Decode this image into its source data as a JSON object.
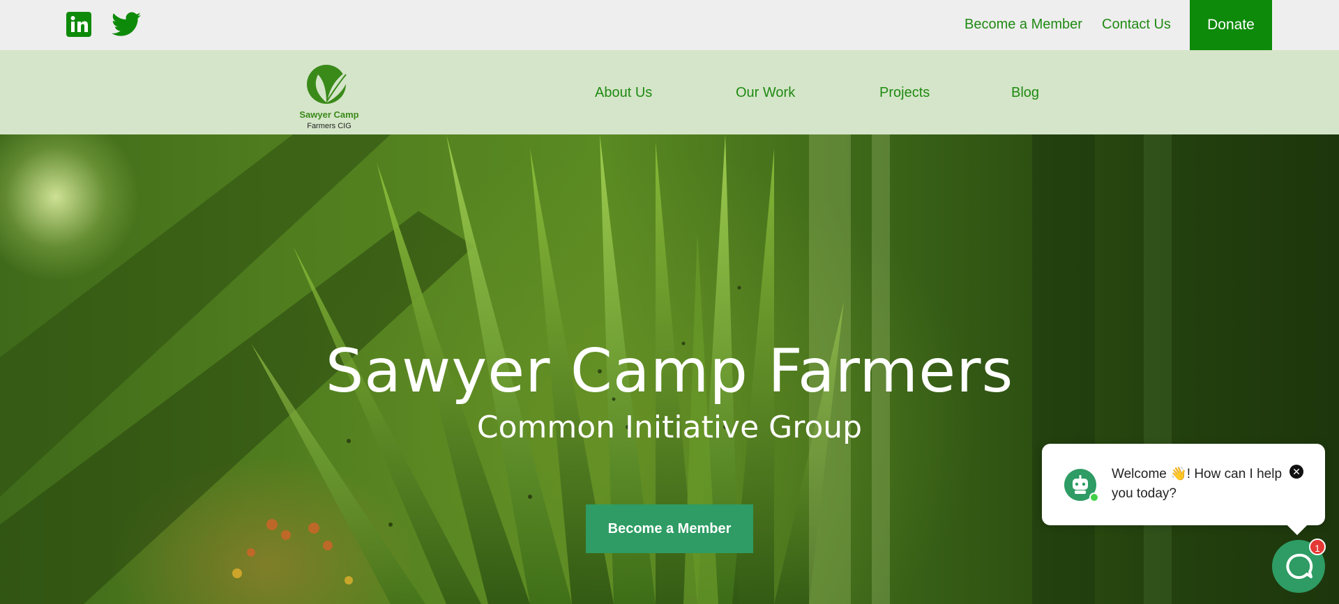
{
  "topbar": {
    "social": [
      {
        "name": "linkedin-icon"
      },
      {
        "name": "twitter-icon"
      }
    ],
    "links": {
      "become_member": "Become a Member",
      "contact_us": "Contact Us",
      "donate": "Donate"
    }
  },
  "nav": {
    "logo": {
      "name": "Sawyer Camp",
      "sub": "Farmers CIG"
    },
    "items": [
      "About Us",
      "Our Work",
      "Projects",
      "Blog"
    ]
  },
  "hero": {
    "title": "Sawyer Camp Farmers",
    "subtitle": "Common Initiative Group",
    "cta": "Become a Member"
  },
  "chat": {
    "message": "Welcome 👋! How can I help you today?",
    "close": "✕",
    "badge": "1"
  },
  "colors": {
    "brand_green": "#1f8a12",
    "donate_bg": "#0e8a0a",
    "nav_bg": "#d5e5c9",
    "cta_bg": "#2e9c64"
  }
}
